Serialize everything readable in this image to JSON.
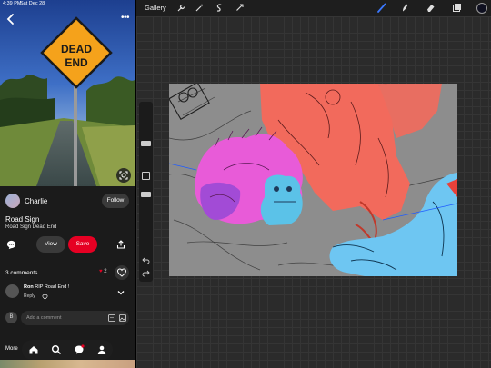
{
  "status_bar": {
    "time": "4:39 PM",
    "date": "Sat Dec 28"
  },
  "pin": {
    "sign_line1": "DEAD",
    "sign_line2": "END",
    "author": {
      "name": "Charlie",
      "follow_label": "Follow"
    },
    "title": "Road Sign",
    "description": "Road Sign Dead End",
    "actions": {
      "view_label": "View",
      "save_label": "Save"
    },
    "comments": {
      "header": "3 comments",
      "likes": "2",
      "items": [
        {
          "author": "Ron",
          "text": "RIP Road End !",
          "reply_label": "Reply"
        }
      ],
      "add_avatar_initial": "B",
      "add_placeholder": "Add a comment"
    },
    "more_label": "More"
  },
  "procreate": {
    "gallery_label": "Gallery",
    "tools": [
      "wrench-icon",
      "magic-wand-icon",
      "selection-icon",
      "transform-icon",
      "brush-icon",
      "smudge-icon",
      "eraser-icon",
      "layers-icon"
    ],
    "colors": {
      "accent": "#3b78ff",
      "current_color": "#0f1020"
    }
  },
  "colors": {
    "save_red": "#e60023",
    "sign_orange": "#f5a21b"
  }
}
